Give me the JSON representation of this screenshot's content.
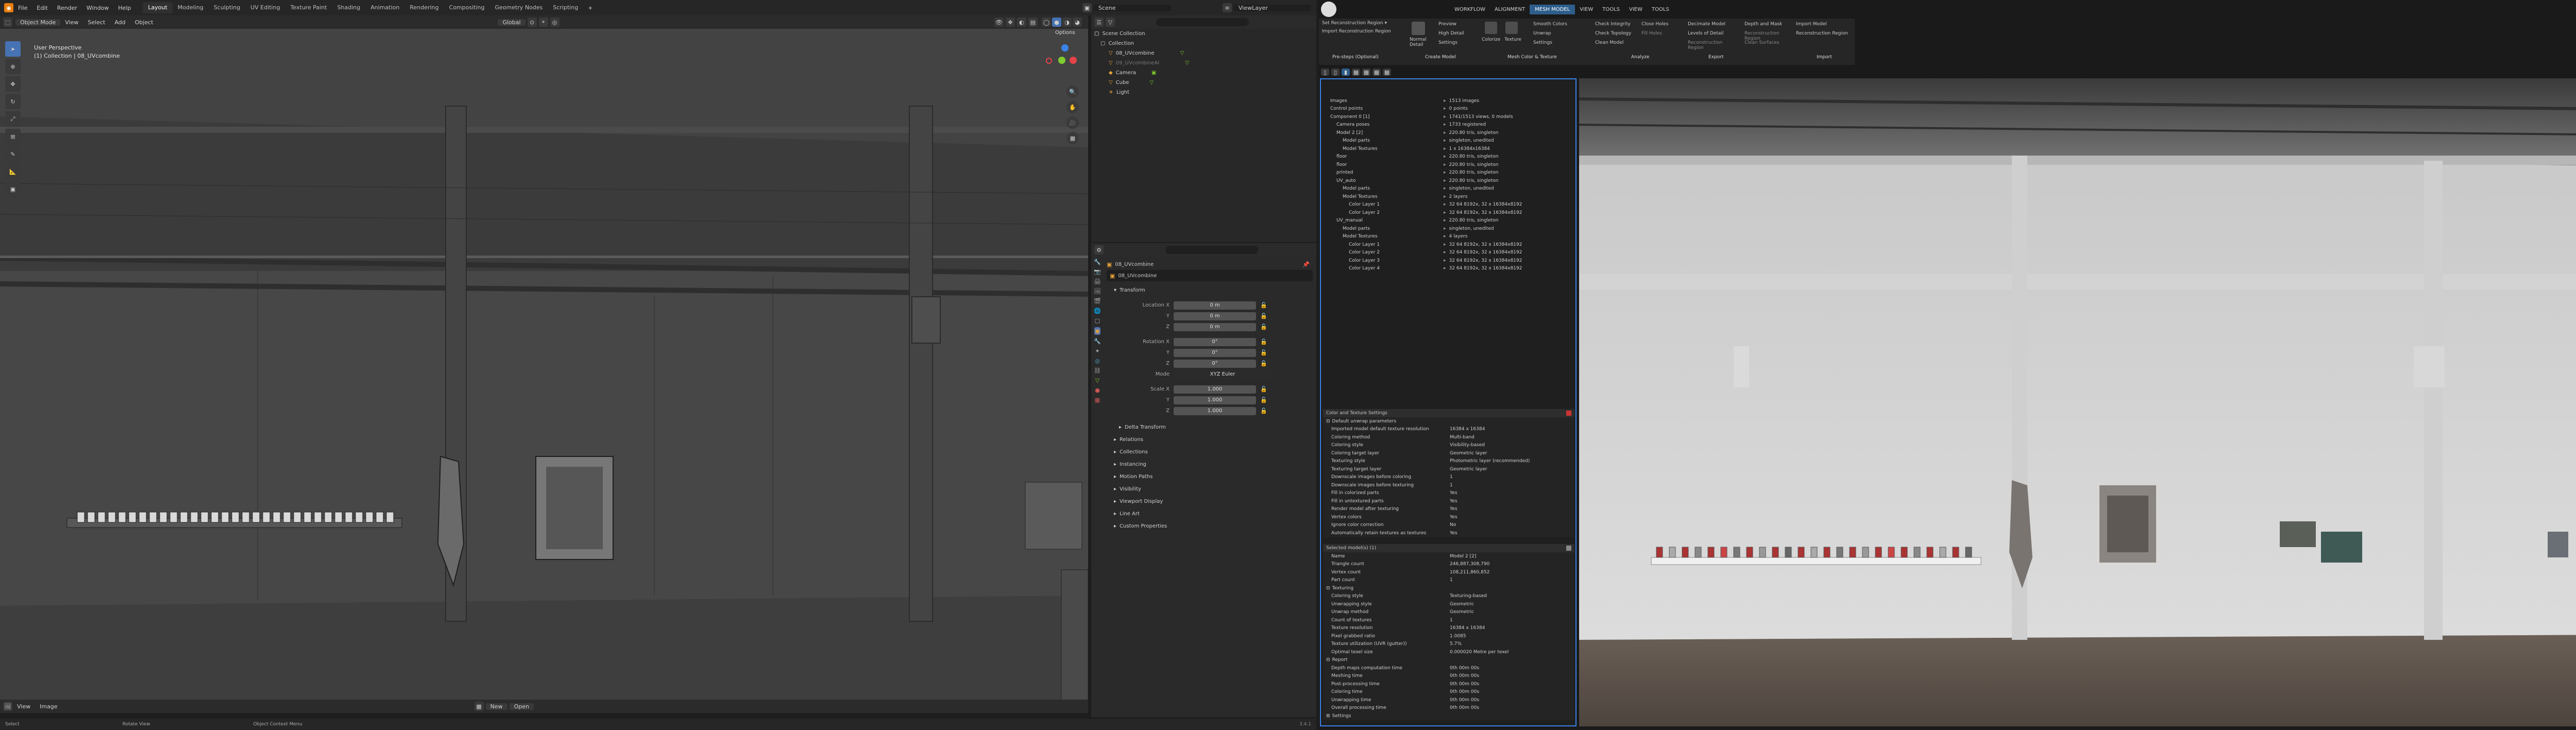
{
  "blender": {
    "topbar": {
      "menus": [
        "File",
        "Edit",
        "Render",
        "Window",
        "Help"
      ],
      "workspaces": [
        "Layout",
        "Modeling",
        "Sculpting",
        "UV Editing",
        "Texture Paint",
        "Shading",
        "Animation",
        "Rendering",
        "Compositing",
        "Geometry Nodes",
        "Scripting"
      ],
      "active_workspace": "Layout",
      "scene": "Scene",
      "view_layer": "ViewLayer"
    },
    "viewport_header": {
      "mode": "Object Mode",
      "menus": [
        "View",
        "Select",
        "Add",
        "Object"
      ],
      "orientation": "Global",
      "options": "Options"
    },
    "viewport": {
      "view_name": "User Perspective",
      "collection_info": "(1) Collection | 08_UVcombine",
      "footer_left": [
        "View",
        "Image"
      ],
      "footer_buttons": [
        "New",
        "Open"
      ]
    },
    "statusbar": {
      "items": [
        "Select",
        "Rotate View",
        "Object Context Menu"
      ],
      "version": "3.4.1"
    },
    "outliner": {
      "title": "Scene Collection",
      "items": [
        {
          "label": "Collection",
          "level": 1
        },
        {
          "label": "08_UVcombine",
          "level": 2
        },
        {
          "label": "09_UVcombineAI",
          "level": 2
        },
        {
          "label": "Camera",
          "level": 2
        },
        {
          "label": "Cube",
          "level": 2
        },
        {
          "label": "Light",
          "level": 2
        }
      ]
    },
    "properties": {
      "object_name": "08_UVcombine",
      "data_name": "08_UVcombine",
      "transform_title": "Transform",
      "location_label": "Location X",
      "location": [
        "0 m",
        "0 m",
        "0 m"
      ],
      "rotation_label": "Rotation X",
      "rotation": [
        "0°",
        "0°",
        "0°"
      ],
      "mode_label": "Mode",
      "mode_value": "XYZ Euler",
      "scale_label": "Scale X",
      "scale": [
        "1.000",
        "1.000",
        "1.000"
      ],
      "axis_labels": [
        "Y",
        "Z"
      ],
      "sections": [
        "Delta Transform",
        "Relations",
        "Collections",
        "Instancing",
        "Motion Paths",
        "Visibility",
        "Viewport Display",
        "Line Art",
        "Custom Properties"
      ]
    }
  },
  "reality_capture": {
    "tabs": [
      "WORKFLOW",
      "ALIGNMENT",
      "MESH MODEL",
      "VIEW",
      "TOOLS",
      "VIEW",
      "TOOLS"
    ],
    "active_tab": "MESH MODEL",
    "ribbon": {
      "prestep": {
        "items": [
          "Set Reconstruction Region ▾",
          "Import Reconstruction Region"
        ],
        "label": "Pre-steps (Optional)"
      },
      "create": {
        "items": [
          "Normal Detail",
          "Preview",
          "High Detail",
          "Settings"
        ],
        "label": "Create Model"
      },
      "color": {
        "items": [
          "Colorize",
          "Texture",
          "Unwrap",
          "Settings"
        ],
        "extra": [
          "Smooth Colors",
          "Unwrap"
        ],
        "label": "Mesh Color & Texture"
      },
      "analyze": {
        "items": [
          "Check Integrity",
          "Check Topology",
          "Clean Model",
          "Close Holes",
          "Fill Holes"
        ],
        "label": "Analyze"
      },
      "export": {
        "items": [
          "Decimate Model",
          "Levels of Detail",
          "Reconstruction Region"
        ],
        "label": "Export"
      },
      "tools": {
        "items": [
          "Depth and Mask",
          "Reconstruction Region",
          "Clean Surfaces"
        ],
        "label": ""
      },
      "import": {
        "items": [
          "Import Model",
          "Reconstruction Region"
        ],
        "label": "Import"
      }
    },
    "tree": [
      {
        "k": "Images",
        "v": "1513 images",
        "indent": 0
      },
      {
        "k": "Control points",
        "v": "0 points",
        "indent": 0
      },
      {
        "k": "Component 0 [1]",
        "v": "1741/1513 views, 0 models",
        "indent": 0
      },
      {
        "k": "Camera poses",
        "v": "1733 registered",
        "indent": 1
      },
      {
        "k": "Model 2 [2]",
        "v": "220.80 tris, singleton",
        "indent": 1
      },
      {
        "k": "Model parts",
        "v": "singleton, unedited",
        "indent": 2
      },
      {
        "k": "Model Textures",
        "v": "1 x 16384x16384",
        "indent": 2
      },
      {
        "k": "floor",
        "v": "220.80 tris, singleton",
        "indent": 1
      },
      {
        "k": "floor",
        "v": "220.80 tris, singleton",
        "indent": 1
      },
      {
        "k": "printed",
        "v": "220.80 tris, singleton",
        "indent": 1
      },
      {
        "k": "UV_auto",
        "v": "220.80 tris, singleton",
        "indent": 1
      },
      {
        "k": "Model parts",
        "v": "singleton, unedited",
        "indent": 2
      },
      {
        "k": "Model Textures",
        "v": "2 layers",
        "indent": 2
      },
      {
        "k": "Color Layer 1",
        "v": "32 64 8192x, 32 x 16384x8192",
        "indent": 3
      },
      {
        "k": "Color Layer 2",
        "v": "32 64 8192x, 32 x 16384x8192",
        "indent": 3
      },
      {
        "k": "UV_manual",
        "v": "220.80 tris, singleton",
        "indent": 1
      },
      {
        "k": "Model parts",
        "v": "singleton, unedited",
        "indent": 2
      },
      {
        "k": "Model Textures",
        "v": "4 layers",
        "indent": 2
      },
      {
        "k": "Color Layer 1",
        "v": "32 64 8192x, 32 x 16384x8192",
        "indent": 3
      },
      {
        "k": "Color Layer 2",
        "v": "32 64 8192x, 32 x 16384x8192",
        "indent": 3
      },
      {
        "k": "Color Layer 3",
        "v": "32 64 8192x, 32 x 16384x8192",
        "indent": 3
      },
      {
        "k": "Color Layer 4",
        "v": "32 64 8192x, 32 x 16384x8192",
        "indent": 3
      }
    ],
    "color_texture": {
      "title": "Color and Texture Settings",
      "group": "Default unwrap parameters",
      "rows": [
        {
          "k": "Imported model default texture resolution",
          "v": "16384 x 16384"
        },
        {
          "k": "Coloring method",
          "v": "Multi-band"
        },
        {
          "k": "Coloring style",
          "v": "Visibility-based"
        },
        {
          "k": "Coloring target layer",
          "v": "Geometric layer"
        },
        {
          "k": "Texturing style",
          "v": "Photometric layer (recommended)"
        },
        {
          "k": "Texturing target layer",
          "v": "Geometric layer"
        },
        {
          "k": "Downscale images before coloring",
          "v": "1"
        },
        {
          "k": "Downscale images before texturing",
          "v": "1"
        },
        {
          "k": "Fill in colorized parts",
          "v": "Yes"
        },
        {
          "k": "Fill in untextured parts",
          "v": "Yes"
        },
        {
          "k": "Render model after texturing",
          "v": "Yes"
        },
        {
          "k": "Vertex colors",
          "v": "Yes"
        },
        {
          "k": "Ignore color correction",
          "v": "No"
        },
        {
          "k": "Automatically retain textures as textures",
          "v": "Yes"
        }
      ]
    },
    "model_info": {
      "title": "Selected model(s) (1)",
      "rows": [
        {
          "k": "Name",
          "v": "Model 2 [2]"
        },
        {
          "k": "Triangle count",
          "v": "246,887,308,790"
        },
        {
          "k": "Vertex count",
          "v": "108,211,860,852"
        },
        {
          "k": "Part count",
          "v": "1"
        }
      ],
      "texturing_title": "Texturing",
      "texturing": [
        {
          "k": "Coloring style",
          "v": "Texturing-based"
        },
        {
          "k": "Unwrapping style",
          "v": "Geometric"
        },
        {
          "k": "Unwrap method",
          "v": "Geometric"
        },
        {
          "k": "Count of textures",
          "v": "1"
        },
        {
          "k": "Texture resolution",
          "v": "16384 x 16384"
        },
        {
          "k": "Pixel grabbed ratio",
          "v": "1.0085"
        },
        {
          "k": "Texture utilization (UVR (gutter))",
          "v": "5.7%"
        },
        {
          "k": "Optimal texel size",
          "v": "0.000020 Metre per texel"
        }
      ],
      "report_title": "Report",
      "report": [
        {
          "k": "Depth maps computation time",
          "v": "0th 00m 00s"
        },
        {
          "k": "Meshing time",
          "v": "0th 00m 00s"
        },
        {
          "k": "Post-processing time",
          "v": "0th 00m 00s"
        },
        {
          "k": "Coloring time",
          "v": "0th 00m 00s"
        },
        {
          "k": "Unwrapping time",
          "v": "0th 00m 00s"
        },
        {
          "k": "Overall processing time",
          "v": "0th 00m 00s"
        }
      ],
      "settings_title": "Settings"
    }
  },
  "colors": {
    "rc_accent": "#1e90ff",
    "blender_active": "#4772b3",
    "viewport_bg": "#3d3d3d"
  }
}
